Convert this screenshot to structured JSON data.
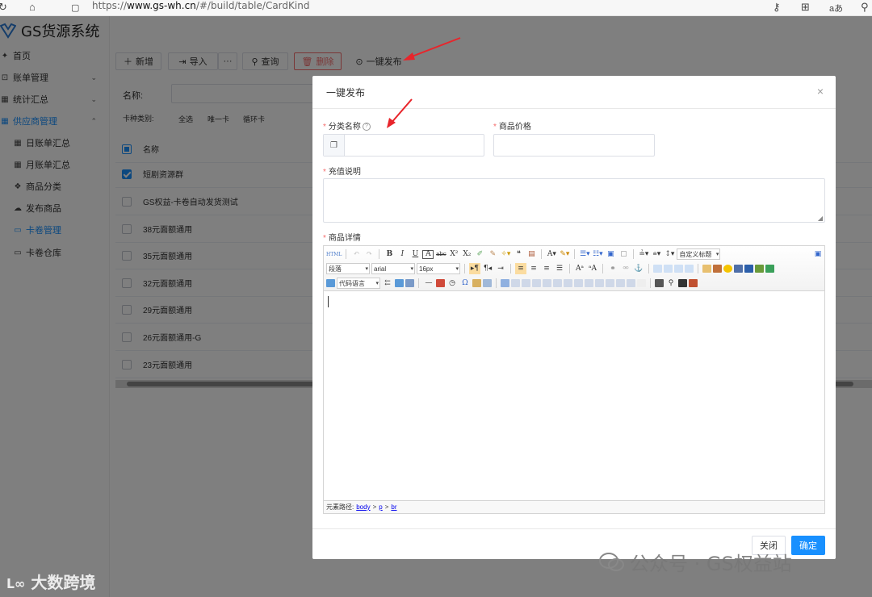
{
  "browser": {
    "url_prefix": "https://",
    "url_host": "www.gs-wh.cn",
    "url_path": "/#/build/table/CardKind"
  },
  "app": {
    "title": "GS货源系统"
  },
  "sidebar": {
    "items": [
      {
        "label": "首页",
        "icon": "home-icon"
      },
      {
        "label": "账单管理",
        "icon": "bill-icon",
        "chevron": "⌄"
      },
      {
        "label": "统计汇总",
        "icon": "table-icon",
        "chevron": "⌄"
      },
      {
        "label": "供应商管理",
        "icon": "table-icon",
        "chevron": "⌃",
        "active": true
      },
      {
        "label": "日账单汇总",
        "icon": "table-icon"
      },
      {
        "label": "月账单汇总",
        "icon": "table-icon"
      },
      {
        "label": "商品分类",
        "icon": "category-icon"
      },
      {
        "label": "发布商品",
        "icon": "upload-icon"
      },
      {
        "label": "卡卷管理",
        "icon": "card-icon",
        "active": true
      },
      {
        "label": "卡卷仓库",
        "icon": "card-icon"
      }
    ]
  },
  "toolbar": {
    "add": "新增",
    "import": "导入",
    "more": "···",
    "query": "查询",
    "delete": "删除",
    "publish": "一键发布"
  },
  "filters": {
    "name_label": "名称:",
    "kind_label": "卡种类别:",
    "kinds": [
      "全选",
      "唯一卡",
      "循环卡"
    ]
  },
  "table": {
    "header": "名称",
    "rows": [
      {
        "name": "短剧资源群",
        "checked": true
      },
      {
        "name": "GS权益-卡卷自动发货测试",
        "checked": false
      },
      {
        "name": "38元面额通用",
        "checked": false
      },
      {
        "name": "35元面额通用",
        "checked": false
      },
      {
        "name": "32元面额通用",
        "checked": false
      },
      {
        "name": "29元面额通用",
        "checked": false
      },
      {
        "name": "26元面额通用-G",
        "checked": false
      },
      {
        "name": "23元面额通用",
        "checked": false
      }
    ]
  },
  "modal": {
    "title": "一键发布",
    "close": "×",
    "category_label": "分类名称",
    "price_label": "商品价格",
    "recharge_label": "充值说明",
    "detail_label": "商品详情",
    "editor": {
      "paragraph": "段落",
      "font": "arial",
      "size": "16px",
      "custom_title": "自定义标题",
      "code_lang": "代码语言",
      "path_label": "元素路径:",
      "path": [
        "body",
        "p",
        "br"
      ]
    },
    "cancel": "关闭",
    "ok": "确定"
  },
  "watermark": {
    "left": "大数跨境",
    "right": "公众号 · GS权益站"
  },
  "colors": {
    "primary": "#1890ff",
    "danger": "#f56c6c",
    "arrow": "#e8252b"
  }
}
